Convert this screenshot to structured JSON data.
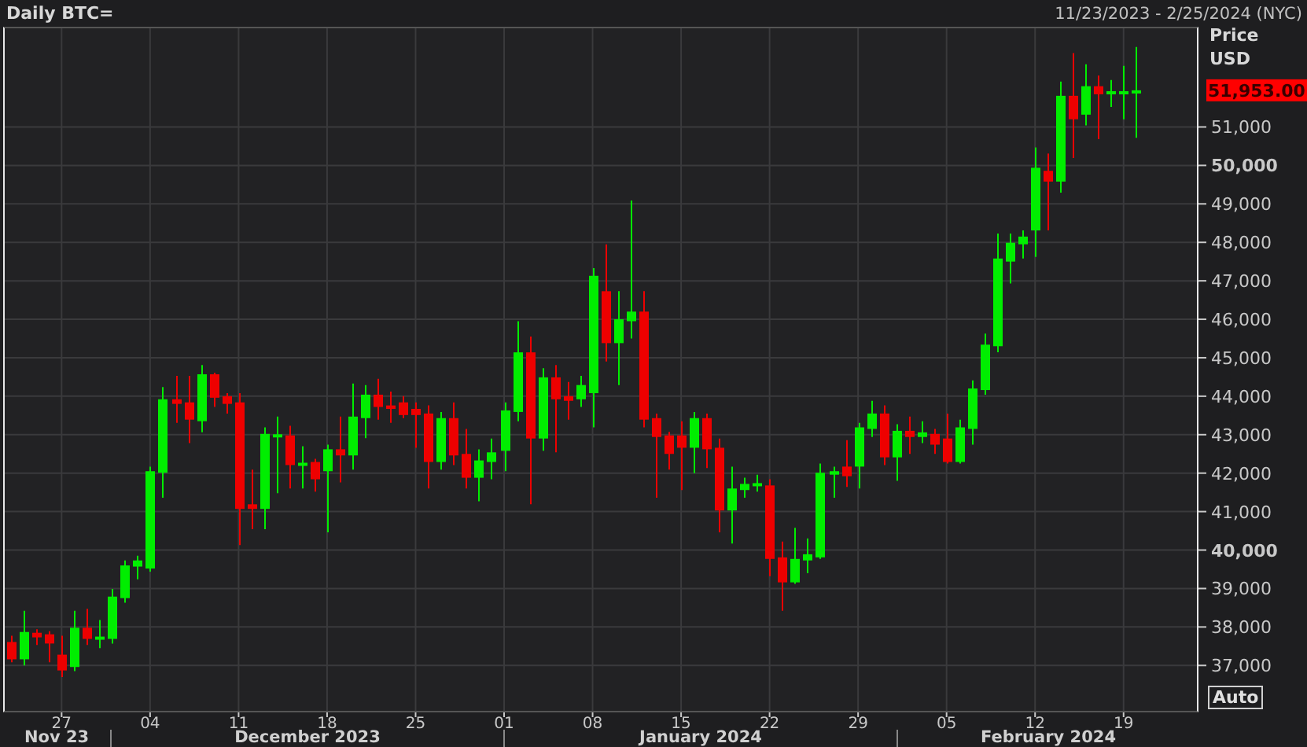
{
  "header": {
    "range": "11/23/2023 - 2/25/2024 (NYC)"
  },
  "axis": {
    "title": "Price",
    "unit": "USD",
    "last_price": "51,953.00",
    "scale_button": "Auto"
  },
  "months": [
    {
      "label": "Nov 23"
    },
    {
      "label": "December 2023"
    },
    {
      "label": "January 2024"
    },
    {
      "label": "February 2024"
    }
  ],
  "chart_data": {
    "type": "candlestick",
    "title": "Daily BTC=",
    "grid": true,
    "x": [
      "2023-11-23",
      "2023-11-24",
      "2023-11-25",
      "2023-11-26",
      "2023-11-27",
      "2023-11-28",
      "2023-11-29",
      "2023-11-30",
      "2023-12-01",
      "2023-12-02",
      "2023-12-03",
      "2023-12-04",
      "2023-12-05",
      "2023-12-06",
      "2023-12-07",
      "2023-12-08",
      "2023-12-09",
      "2023-12-10",
      "2023-12-11",
      "2023-12-12",
      "2023-12-13",
      "2023-12-14",
      "2023-12-15",
      "2023-12-16",
      "2023-12-17",
      "2023-12-18",
      "2023-12-19",
      "2023-12-20",
      "2023-12-21",
      "2023-12-22",
      "2023-12-23",
      "2023-12-24",
      "2023-12-25",
      "2023-12-26",
      "2023-12-27",
      "2023-12-28",
      "2023-12-29",
      "2023-12-30",
      "2023-12-31",
      "2024-01-01",
      "2024-01-02",
      "2024-01-03",
      "2024-01-04",
      "2024-01-05",
      "2024-01-06",
      "2024-01-07",
      "2024-01-08",
      "2024-01-09",
      "2024-01-10",
      "2024-01-11",
      "2024-01-12",
      "2024-01-13",
      "2024-01-14",
      "2024-01-15",
      "2024-01-16",
      "2024-01-17",
      "2024-01-18",
      "2024-01-19",
      "2024-01-20",
      "2024-01-21",
      "2024-01-22",
      "2024-01-23",
      "2024-01-24",
      "2024-01-25",
      "2024-01-26",
      "2024-01-27",
      "2024-01-28",
      "2024-01-29",
      "2024-01-30",
      "2024-01-31",
      "2024-02-01",
      "2024-02-02",
      "2024-02-03",
      "2024-02-04",
      "2024-02-05",
      "2024-02-06",
      "2024-02-07",
      "2024-02-08",
      "2024-02-09",
      "2024-02-10",
      "2024-02-11",
      "2024-02-12",
      "2024-02-13",
      "2024-02-14",
      "2024-02-15",
      "2024-02-16",
      "2024-02-17",
      "2024-02-18",
      "2024-02-19",
      "2024-02-20"
    ],
    "xlim": [
      "2023-11-22T12:00:00Z",
      "2024-02-24T19:12:00Z"
    ],
    "ylim": [
      35820,
      53565
    ],
    "xticks": [
      {
        "value": "2023-11-27",
        "label": "27"
      },
      {
        "value": "2023-12-04",
        "label": "04"
      },
      {
        "value": "2023-12-11",
        "label": "11"
      },
      {
        "value": "2023-12-18",
        "label": "18"
      },
      {
        "value": "2023-12-25",
        "label": "25"
      },
      {
        "value": "2024-01-01",
        "label": "01"
      },
      {
        "value": "2024-01-08",
        "label": "08"
      },
      {
        "value": "2024-01-15",
        "label": "15"
      },
      {
        "value": "2024-01-22",
        "label": "22"
      },
      {
        "value": "2024-01-29",
        "label": "29"
      },
      {
        "value": "2024-02-05",
        "label": "05"
      },
      {
        "value": "2024-02-12",
        "label": "12"
      },
      {
        "value": "2024-02-19",
        "label": "19"
      }
    ],
    "yticks": [
      {
        "value": 37000,
        "label": "37,000"
      },
      {
        "value": 38000,
        "label": "38,000"
      },
      {
        "value": 39000,
        "label": "39,000"
      },
      {
        "value": 40000,
        "label": "40,000"
      },
      {
        "value": 41000,
        "label": "41,000"
      },
      {
        "value": 42000,
        "label": "42,000"
      },
      {
        "value": 43000,
        "label": "43,000"
      },
      {
        "value": 44000,
        "label": "44,000"
      },
      {
        "value": 45000,
        "label": "45,000"
      },
      {
        "value": 46000,
        "label": "46,000"
      },
      {
        "value": 47000,
        "label": "47,000"
      },
      {
        "value": 48000,
        "label": "48,000"
      },
      {
        "value": 49000,
        "label": "49,000"
      },
      {
        "value": 50000,
        "label": "50,000"
      },
      {
        "value": 51000,
        "label": "51,000"
      }
    ],
    "ohlc": [
      [
        37610,
        37770,
        37080,
        37160
      ],
      [
        37160,
        38420,
        37000,
        37870
      ],
      [
        37850,
        37940,
        37530,
        37730
      ],
      [
        37810,
        37890,
        37080,
        37570
      ],
      [
        37280,
        37770,
        36700,
        36870
      ],
      [
        36960,
        38420,
        36850,
        37980
      ],
      [
        37980,
        38470,
        37530,
        37690
      ],
      [
        37690,
        38180,
        37450,
        37750
      ],
      [
        37690,
        38990,
        37570,
        38790
      ],
      [
        38750,
        39730,
        38630,
        39600
      ],
      [
        39570,
        39850,
        39240,
        39730
      ],
      [
        39520,
        42170,
        39440,
        42050
      ],
      [
        42010,
        44240,
        41360,
        43920
      ],
      [
        43920,
        44530,
        43310,
        43800
      ],
      [
        43840,
        44530,
        42780,
        43390
      ],
      [
        43350,
        44810,
        43060,
        44570
      ],
      [
        44570,
        44610,
        43720,
        43960
      ],
      [
        44000,
        44080,
        43550,
        43800
      ],
      [
        43840,
        44080,
        40130,
        41070
      ],
      [
        41190,
        42090,
        40540,
        41070
      ],
      [
        41070,
        43190,
        40540,
        43020
      ],
      [
        42950,
        43470,
        41480,
        43010
      ],
      [
        42980,
        43230,
        41600,
        42210
      ],
      [
        42230,
        42700,
        41600,
        42270
      ],
      [
        42290,
        42370,
        41520,
        41840
      ],
      [
        42050,
        42740,
        40460,
        42620
      ],
      [
        42620,
        43470,
        41760,
        42460
      ],
      [
        42460,
        44330,
        42090,
        43470
      ],
      [
        43430,
        44290,
        42910,
        44040
      ],
      [
        44040,
        44450,
        43390,
        43720
      ],
      [
        43760,
        44120,
        43310,
        43670
      ],
      [
        43840,
        44000,
        43430,
        43510
      ],
      [
        43670,
        43840,
        42660,
        43510
      ],
      [
        43550,
        43760,
        41600,
        42290
      ],
      [
        42290,
        43590,
        42090,
        43430
      ],
      [
        43430,
        43840,
        42210,
        42460
      ],
      [
        42500,
        43150,
        41600,
        41880
      ],
      [
        41880,
        42620,
        41270,
        42330
      ],
      [
        42290,
        42900,
        41840,
        42540
      ],
      [
        42580,
        43840,
        42050,
        43630
      ],
      [
        43590,
        45950,
        43350,
        45140
      ],
      [
        45140,
        45550,
        41190,
        42900
      ],
      [
        42900,
        44730,
        42580,
        44490
      ],
      [
        44490,
        44810,
        42540,
        43920
      ],
      [
        44000,
        44370,
        43390,
        43880
      ],
      [
        43920,
        44530,
        43720,
        44290
      ],
      [
        44080,
        47330,
        43190,
        47130
      ],
      [
        46730,
        47950,
        44900,
        45380
      ],
      [
        45380,
        46730,
        44290,
        46000
      ],
      [
        45950,
        49090,
        45500,
        46200
      ],
      [
        46200,
        46730,
        43190,
        43390
      ],
      [
        43430,
        43550,
        41360,
        42940
      ],
      [
        42980,
        43070,
        42090,
        42500
      ],
      [
        42980,
        43350,
        41560,
        42660
      ],
      [
        42660,
        43590,
        42000,
        43430
      ],
      [
        43430,
        43550,
        42130,
        42620
      ],
      [
        42660,
        42900,
        40460,
        41030
      ],
      [
        41030,
        42170,
        40170,
        41600
      ],
      [
        41560,
        41880,
        41360,
        41720
      ],
      [
        41700,
        41960,
        41520,
        41740
      ],
      [
        41680,
        41840,
        39320,
        39770
      ],
      [
        39810,
        40220,
        38420,
        39160
      ],
      [
        39160,
        40580,
        39120,
        39770
      ],
      [
        39730,
        40300,
        39400,
        39890
      ],
      [
        39810,
        42250,
        39770,
        42010
      ],
      [
        41960,
        42170,
        41360,
        42050
      ],
      [
        42170,
        42860,
        41640,
        41920
      ],
      [
        42170,
        43310,
        41600,
        43190
      ],
      [
        43150,
        43880,
        42940,
        43550
      ],
      [
        43550,
        43760,
        42210,
        42410
      ],
      [
        42410,
        43270,
        41800,
        43100
      ],
      [
        43100,
        43470,
        42500,
        42940
      ],
      [
        42940,
        43350,
        42780,
        43060
      ],
      [
        43020,
        43150,
        42500,
        42740
      ],
      [
        42900,
        43550,
        42250,
        42290
      ],
      [
        42290,
        43390,
        42250,
        43190
      ],
      [
        43150,
        44410,
        42740,
        44200
      ],
      [
        44160,
        45630,
        44040,
        45340
      ],
      [
        45300,
        48230,
        45140,
        47580
      ],
      [
        47500,
        48230,
        46930,
        47990
      ],
      [
        47950,
        48310,
        47580,
        48150
      ],
      [
        48310,
        50470,
        47620,
        49940
      ],
      [
        49860,
        50310,
        48310,
        49580
      ],
      [
        49580,
        52180,
        49290,
        51810
      ],
      [
        51810,
        52920,
        50190,
        51200
      ],
      [
        51320,
        52630,
        51040,
        52060
      ],
      [
        52060,
        52340,
        50680,
        51850
      ],
      [
        51850,
        52220,
        51520,
        51930
      ],
      [
        51890,
        52590,
        51200,
        51930
      ],
      [
        51890,
        53080,
        50720,
        51953
      ]
    ]
  }
}
